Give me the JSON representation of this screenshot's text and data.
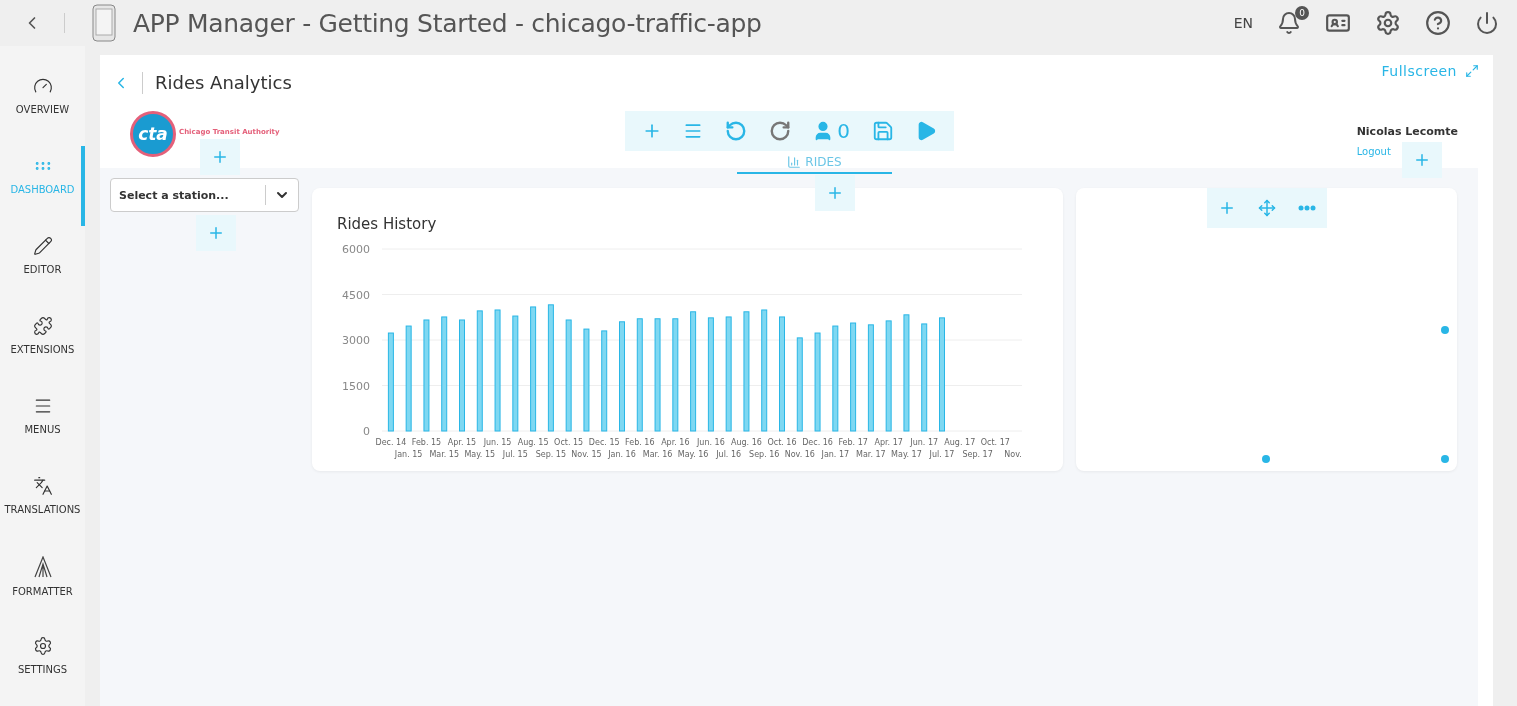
{
  "topbar": {
    "title": "APP Manager - Getting Started - chicago-traffic-app",
    "language": "EN",
    "notification_count": "0"
  },
  "sidebar": {
    "items": [
      {
        "label": "OVERVIEW",
        "selected": false
      },
      {
        "label": "DASHBOARD",
        "selected": true
      },
      {
        "label": "EDITOR",
        "selected": false
      },
      {
        "label": "EXTENSIONS",
        "selected": false
      },
      {
        "label": "MENUS",
        "selected": false
      },
      {
        "label": "TRANSLATIONS",
        "selected": false
      },
      {
        "label": "FORMATTER",
        "selected": false
      },
      {
        "label": "SETTINGS",
        "selected": false
      }
    ]
  },
  "page": {
    "title": "Rides Analytics",
    "fullscreen": "Fullscreen"
  },
  "header": {
    "logo_mark": "cta",
    "logo_text": "Chicago Transit Authority",
    "toolbar": {
      "user_count": "0"
    },
    "user": {
      "name": "Nicolas Lecomte",
      "logout": "Logout"
    }
  },
  "tabs": [
    {
      "label": "RIDES",
      "selected": true
    }
  ],
  "station_select": {
    "placeholder": "Select a station..."
  },
  "widgets": [
    {
      "kind": "chart",
      "title": "Rides History",
      "chart_data": {
        "type": "bar",
        "categories": [
          "Dec. 14",
          "Jan. 15",
          "Feb. 15",
          "Mar. 15",
          "Apr. 15",
          "May. 15",
          "Jun. 15",
          "Jul. 15",
          "Aug. 15",
          "Sep. 15",
          "Oct. 15",
          "Nov. 15",
          "Dec. 15",
          "Jan. 16",
          "Feb. 16",
          "Mar. 16",
          "Apr. 16",
          "May. 16",
          "Jun. 16",
          "Jul. 16",
          "Aug. 16",
          "Sep. 16",
          "Oct. 16",
          "Nov. 16",
          "Dec. 16",
          "Jan. 17",
          "Feb. 17",
          "Mar. 17",
          "Apr. 17",
          "May. 17",
          "Jun. 17",
          "Jul. 17",
          "Aug. 17",
          "Sep. 17",
          "Oct. 17",
          "Nov."
        ],
        "series": [
          {
            "color": "#29b6e6",
            "values": [
              3230,
              3460,
              3660,
              3760,
              3660,
              3960,
              3990,
              3790,
              4090,
              4160,
              3660,
              3360,
              3300,
              3600,
              3700,
              3700,
              3700,
              3930,
              3730,
              3760,
              3930,
              3990,
              3760,
              3070,
              3230,
              3460,
              3560,
              3500,
              3630,
              3830,
              3530,
              3730,
              null,
              null,
              null,
              null
            ]
          }
        ],
        "grid": true,
        "ylim": [
          0,
          6000
        ],
        "yticks": [
          0,
          1500,
          3000,
          4500,
          6000
        ]
      }
    },
    {
      "kind": "empty"
    }
  ]
}
